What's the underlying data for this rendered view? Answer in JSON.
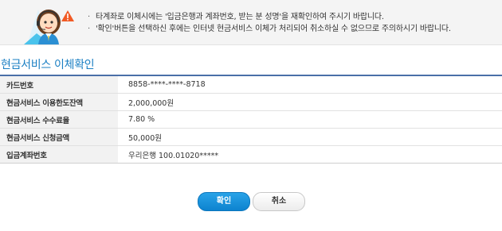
{
  "notice": {
    "items": [
      "타계좌로 이체시에는 '입금은행과 계좌번호, 받는 분 성명'을 재확인하여 주시기 바랍니다.",
      "'확인'버튼을 선택하신 후에는 인터넷 현금서비스 이체가 처리되어 취소하실 수 없으므로 주의하시기 바랍니다."
    ],
    "bullet": "·"
  },
  "page_title": "현금서비스 이체확인",
  "details": [
    {
      "label": "카드번호",
      "value": "8858-****-****-8718"
    },
    {
      "label": "현금서비스 이용한도잔액",
      "value": "2,000,000원"
    },
    {
      "label": "현금서비스 수수료율",
      "value": "7.80 %"
    },
    {
      "label": "현금서비스 신청금액",
      "value": "50,000원"
    },
    {
      "label": "입금계좌번호",
      "value": "우리은행 100.01020*****"
    }
  ],
  "buttons": {
    "confirm": "확인",
    "cancel": "취소"
  },
  "colors": {
    "accent": "#1a7fc3",
    "confirm_button": "#1592dc",
    "table_rule": "#4a6fa8"
  },
  "icons": {
    "illustration": "operator-with-warning-icon",
    "warning": "warning-icon"
  }
}
